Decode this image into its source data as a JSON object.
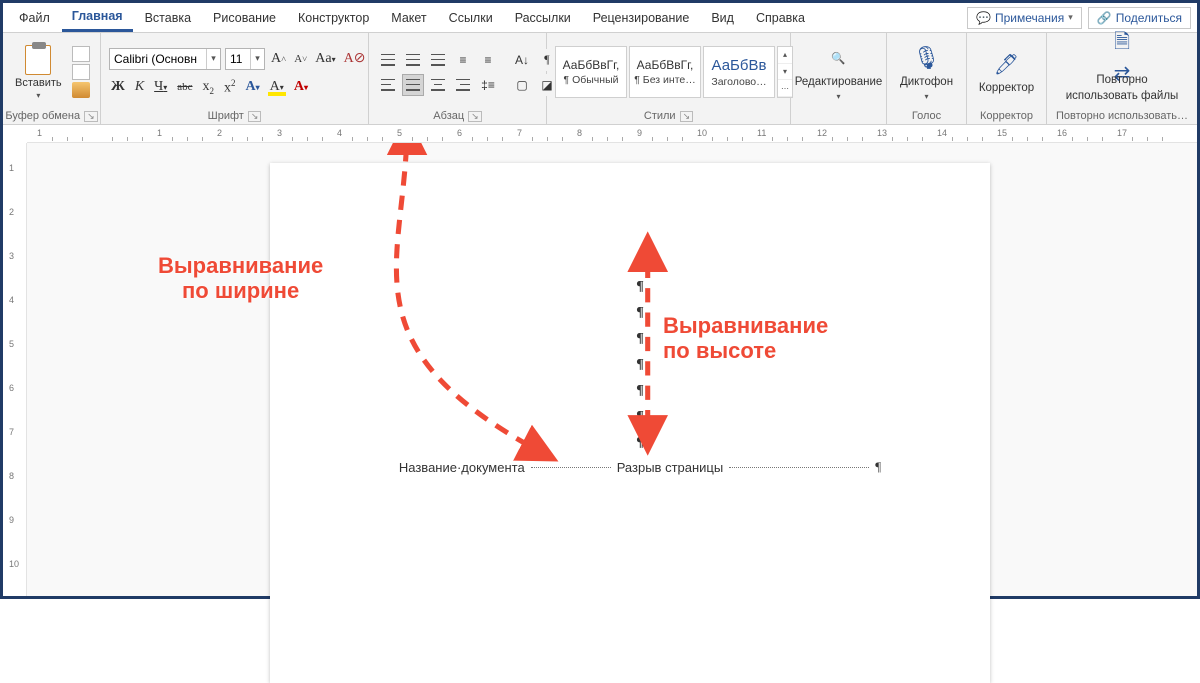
{
  "tabs": {
    "file": "Файл",
    "home": "Главная",
    "insert": "Вставка",
    "draw": "Рисование",
    "design": "Конструктор",
    "layout": "Макет",
    "references": "Ссылки",
    "mail": "Рассылки",
    "review": "Рецензирование",
    "view": "Вид",
    "help": "Справка"
  },
  "topRight": {
    "comments": "Примечания",
    "share": "Поделиться"
  },
  "clipboard": {
    "paste": "Вставить",
    "label": "Буфер обмена"
  },
  "font": {
    "name": "Calibri (Основн",
    "size": "11",
    "label": "Шрифт",
    "bold": "Ж",
    "italic": "К",
    "underline": "Ч",
    "strike": "abc",
    "sub": "x",
    "sup": "x",
    "effectA": "A",
    "highlightA": "A",
    "colorA": "A",
    "caseAa": "Aa",
    "incA": "A",
    "decA": "A",
    "clear": "A"
  },
  "paragraph": {
    "label": "Абзац"
  },
  "styles": {
    "label": "Стили",
    "preview": "АаБбВвГг,",
    "previewHeading": "АаБбВв",
    "normal": "¶ Обычный",
    "noSpacing": "¶ Без инте…",
    "heading1": "Заголово…"
  },
  "editing": {
    "label": "Редактирование"
  },
  "voice": {
    "btn": "Диктофон",
    "label": "Голос"
  },
  "editor": {
    "btn": "Корректор",
    "label": "Корректор"
  },
  "reuse": {
    "btn1": "Повторно",
    "btn2": "использовать файлы",
    "label": "Повторно использовать…"
  },
  "doc": {
    "title": "Название·документа",
    "pageBreak": "Разрыв страницы"
  },
  "ruler": {
    "h": [
      "1",
      "",
      "1",
      "2",
      "3",
      "4",
      "5",
      "6",
      "7",
      "8",
      "9",
      "10",
      "11",
      "12",
      "13",
      "14",
      "15",
      "16",
      "17"
    ],
    "v": [
      "1",
      "2",
      "3",
      "4",
      "5",
      "6",
      "7",
      "8",
      "9",
      "10"
    ]
  },
  "annotations": {
    "width1": "Выравнивание",
    "width2": "по ширине",
    "height1": "Выравнивание",
    "height2": "по высоте"
  }
}
